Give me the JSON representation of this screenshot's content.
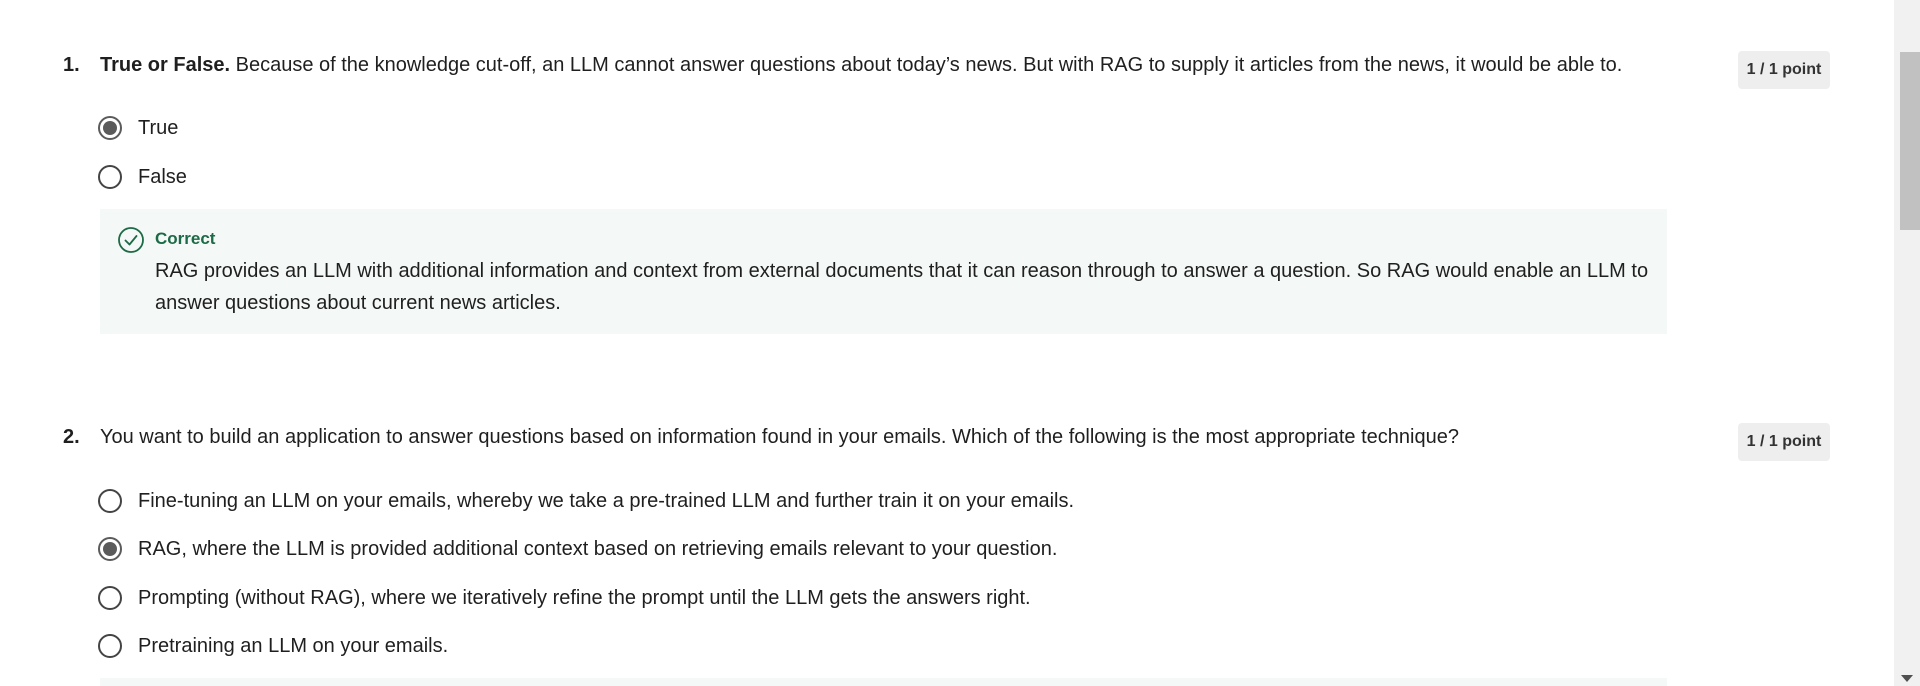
{
  "questions": [
    {
      "number": "1.",
      "prefix": "True or False.",
      "text": " Because of the knowledge cut-off, an LLM cannot answer questions about today’s news. But with RAG to supply it articles from the news, it would be able to.",
      "points": "1 / 1 point",
      "options": [
        {
          "label": "True",
          "selected": true
        },
        {
          "label": "False",
          "selected": false
        }
      ],
      "feedback": {
        "status": "Correct",
        "text": "RAG provides an LLM with additional information and context from external documents that it can reason through to answer a question. So RAG would enable an LLM to answer questions about current news articles."
      }
    },
    {
      "number": "2.",
      "text": "You want to build an application to answer questions based on information found in your emails. Which of the following is the most appropriate technique?",
      "points": "1 / 1 point",
      "options": [
        {
          "label": "Fine-tuning an LLM on your emails, whereby we take a pre-trained LLM and further train it on your emails.",
          "selected": false
        },
        {
          "label": "RAG, where the LLM is provided additional context based on retrieving emails relevant to your question.",
          "selected": true
        },
        {
          "label": "Prompting (without RAG), where we iteratively refine the prompt until the LLM gets the answers right.",
          "selected": false
        },
        {
          "label": "Pretraining an LLM on your emails.",
          "selected": false
        }
      ]
    }
  ],
  "colors": {
    "correct_green": "#1d6a46",
    "feedback_bg": "#f4f8f6",
    "points_bg": "#eeeeee"
  },
  "icons": {
    "feedback": "check-circle-icon",
    "radio": "radio-button-icon"
  }
}
